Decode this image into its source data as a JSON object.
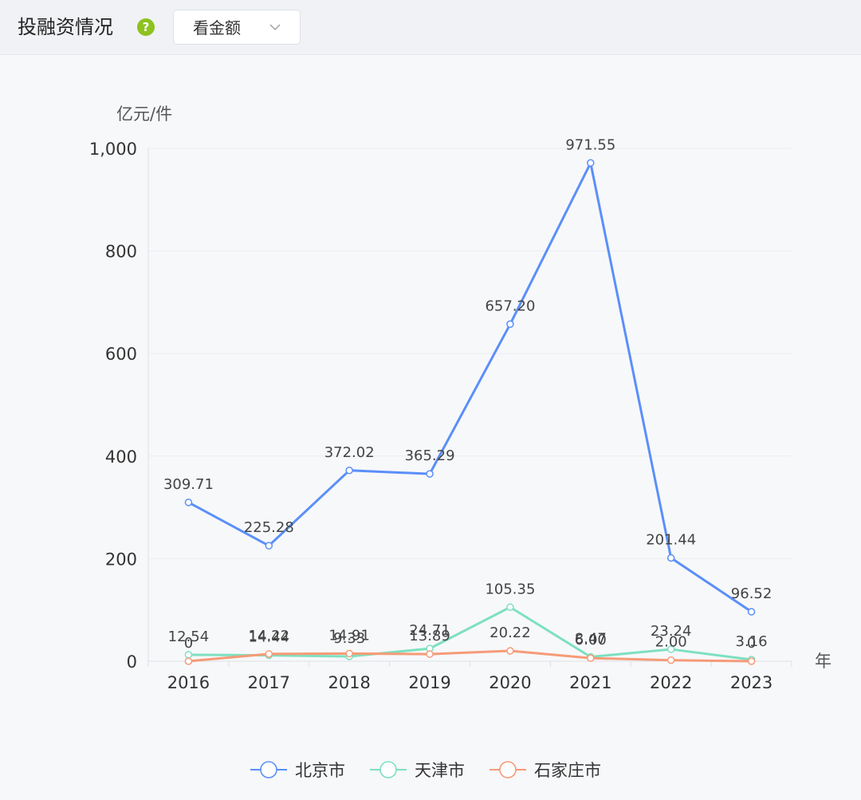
{
  "header": {
    "title": "投融资情况",
    "help_icon": "question-circle-icon",
    "help_glyph": "?",
    "select": {
      "selected": "看金额"
    }
  },
  "colors": {
    "beijing": "#5b8ff9",
    "tianjin": "#7ee0c0",
    "shijiazhuang": "#f69b78",
    "help": "#8dc21f"
  },
  "chart_data": {
    "type": "line",
    "title": "",
    "ylabel": "亿元/件",
    "xlabel": "年",
    "ylim": [
      0,
      1000
    ],
    "yticks": [
      "0",
      "200",
      "400",
      "600",
      "800",
      "1,000"
    ],
    "categories": [
      "2016",
      "2017",
      "2018",
      "2019",
      "2020",
      "2021",
      "2022",
      "2023"
    ],
    "series": [
      {
        "name": "北京市",
        "values": [
          309.71,
          225.28,
          372.02,
          365.29,
          657.2,
          971.55,
          201.44,
          96.52
        ],
        "labels": [
          "309.71",
          "225.28",
          "372.02",
          "365.29",
          "657.20",
          "971.55",
          "201.44",
          "96.52"
        ]
      },
      {
        "name": "天津市",
        "values": [
          12.54,
          11.44,
          9.33,
          24.71,
          105.35,
          8.47,
          23.24,
          3.16
        ],
        "labels": [
          "12.54",
          "14.44",
          "9.33",
          "24.71",
          "105.35",
          "8.47",
          "23.24",
          "3.16"
        ]
      },
      {
        "name": "石家庄市",
        "values": [
          0,
          14.22,
          14.91,
          13.89,
          20.22,
          6.0,
          2.0,
          0
        ],
        "labels": [
          "0",
          "14.22",
          "14.91",
          "13.89",
          "20.22",
          "6.00",
          "2.00",
          "0"
        ]
      }
    ],
    "legend": "bottom-center",
    "grid": true
  }
}
